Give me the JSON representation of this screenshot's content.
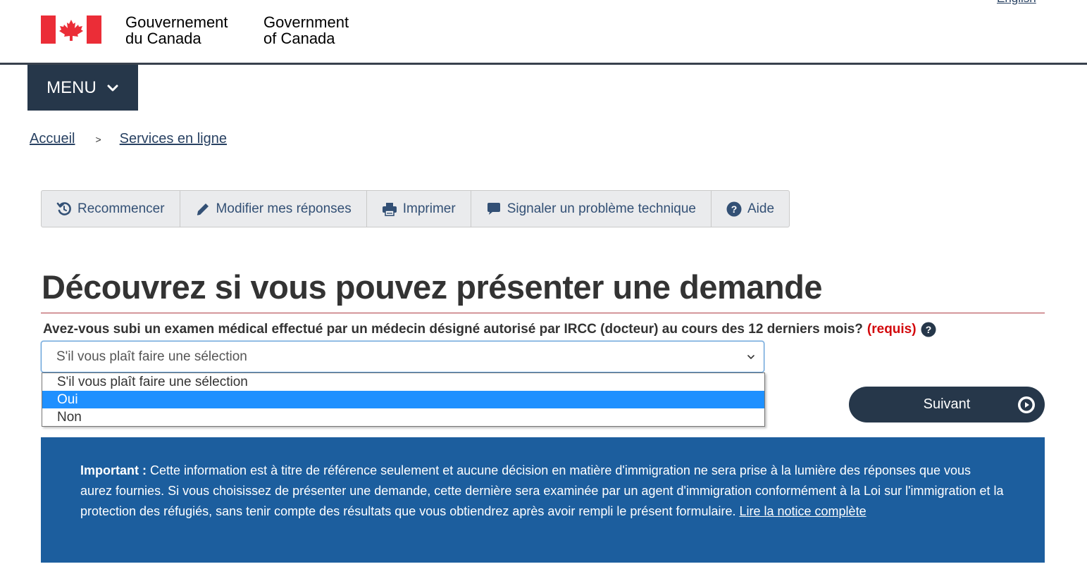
{
  "header": {
    "language_link": "English",
    "signature_fr_line1": "Gouvernement",
    "signature_fr_line2": "du Canada",
    "signature_en_line1": "Government",
    "signature_en_line2": "of Canada",
    "flag_icon": "canada-flag-icon",
    "flag_color": "#eb2d37"
  },
  "menu": {
    "label": "MENU",
    "icon": "chevron-down-icon"
  },
  "breadcrumb": {
    "items": [
      "Accueil",
      "Services en ligne"
    ],
    "separator": ">"
  },
  "toolbar": {
    "buttons": [
      {
        "label": "Recommencer",
        "icon": "restart-icon"
      },
      {
        "label": "Modifier mes réponses",
        "icon": "pencil-icon"
      },
      {
        "label": "Imprimer",
        "icon": "printer-icon"
      },
      {
        "label": "Signaler un problème technique",
        "icon": "comment-icon"
      },
      {
        "label": "Aide",
        "icon": "help-icon"
      }
    ]
  },
  "main": {
    "title": "Découvrez si vous pouvez présenter une demande",
    "question": {
      "text": "Avez-vous subi un examen médical effectué par un médecin désigné autorisé par IRCC (docteur) au cours des 12 derniers mois?",
      "required_label": "(requis)",
      "help_icon": "help-icon"
    },
    "select": {
      "value": "S'il vous plaît faire une sélection",
      "options": [
        "S'il vous plaît faire une sélection",
        "Oui",
        "Non"
      ],
      "highlighted_option": "Oui"
    },
    "next_button": {
      "label": "Suivant",
      "icon": "play-circle-icon"
    }
  },
  "notice": {
    "lead": "Important :",
    "text": " Cette information est à titre de référence seulement et aucune décision en matière d'immigration ne sera prise à la lumière des réponses que vous aurez fournies. Si vous choisissez de présenter une demande, cette dernière sera examinée par un agent d'immigration conformément à la Loi sur l'immigration et la protection des réfugiés, sans tenir compte des résultats que vous obtiendrez après avoir rempli le présent formulaire. ",
    "link": "Lire la notice complète"
  },
  "colors": {
    "nav_dark": "#26374a",
    "link": "#284162",
    "notice_bg": "#1c5e9e",
    "required_red": "#d3080c",
    "option_highlight": "#1e90ff",
    "title_rule": "#af3c43"
  }
}
